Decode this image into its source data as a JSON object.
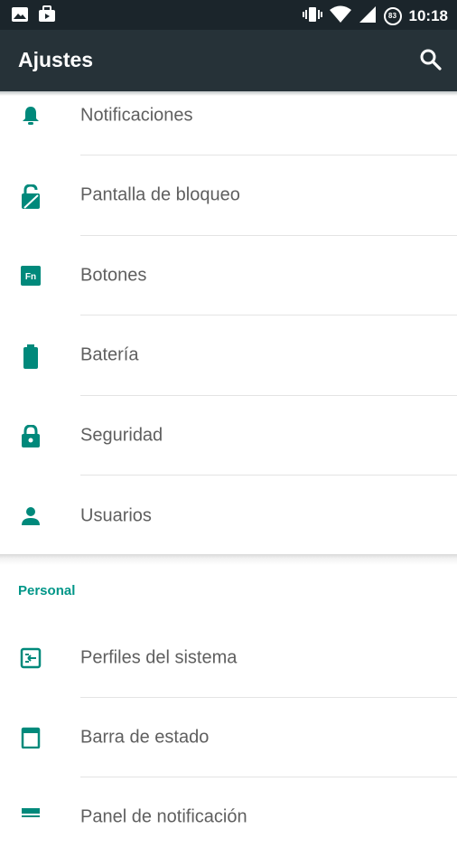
{
  "status_bar": {
    "time": "10:18",
    "battery_level": "83",
    "left_icons": [
      "image-notification-icon",
      "shopping-bag-icon"
    ],
    "right_icons": [
      "vibrate-icon",
      "wifi-icon",
      "signal-icon",
      "battery-icon"
    ]
  },
  "app_bar": {
    "title": "Ajustes",
    "search_icon": "search-icon"
  },
  "items_device": [
    {
      "label": "Notificaciones",
      "icon": "bell-icon"
    },
    {
      "label": "Pantalla de bloqueo",
      "icon": "lockscreen-icon"
    },
    {
      "label": "Botones",
      "icon": "fn-key-icon"
    },
    {
      "label": "Batería",
      "icon": "battery-icon"
    },
    {
      "label": "Seguridad",
      "icon": "lock-icon"
    },
    {
      "label": "Usuarios",
      "icon": "person-icon"
    }
  ],
  "personal_section": {
    "header": "Personal",
    "items": [
      {
        "label": "Perfiles del sistema",
        "icon": "profiles-icon"
      },
      {
        "label": "Barra de estado",
        "icon": "status-bar-icon"
      },
      {
        "label": "Panel de notificación",
        "icon": "notification-panel-icon"
      }
    ]
  },
  "colors": {
    "accent": "#009688",
    "appbar": "#263238",
    "statusbar": "#1b252b",
    "text": "#5f5f5f"
  }
}
